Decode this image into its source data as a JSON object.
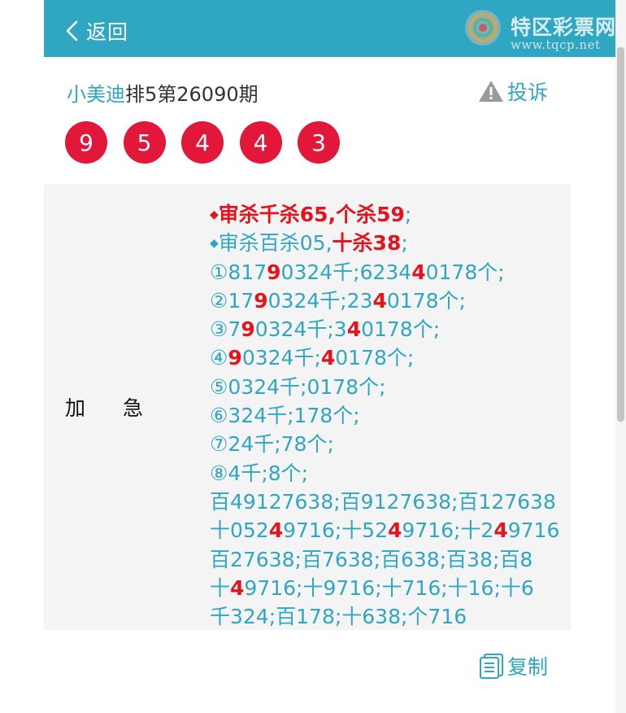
{
  "header": {
    "back_label": "返回"
  },
  "logo": {
    "name": "特区彩票网",
    "url": "www.tqcp.net"
  },
  "title": {
    "brand": "小美迪",
    "rest": "排5第26090期"
  },
  "complain_label": "投诉",
  "balls": [
    "9",
    "5",
    "4",
    "4",
    "3"
  ],
  "row_label": [
    "加",
    "急"
  ],
  "lines": [
    [
      {
        "t": "◆",
        "c": "d-red"
      },
      {
        "t": "审杀千杀65,个杀59",
        "c": "hl"
      },
      {
        "t": ";",
        "c": ""
      }
    ],
    [
      {
        "t": "◆",
        "c": "d-blue"
      },
      {
        "t": "审杀百杀05,",
        "c": ""
      },
      {
        "t": "十杀38",
        "c": "hl"
      },
      {
        "t": ";",
        "c": ""
      }
    ],
    [
      {
        "t": "①817",
        "c": ""
      },
      {
        "t": "9",
        "c": "hl"
      },
      {
        "t": "0324千;6234",
        "c": ""
      },
      {
        "t": "4",
        "c": "hl-skip"
      },
      {
        "t": "0178个;",
        "c": ""
      }
    ],
    [
      {
        "t": "②17",
        "c": ""
      },
      {
        "t": "9",
        "c": "hl"
      },
      {
        "t": "0324千;23",
        "c": ""
      },
      {
        "t": "4",
        "c": "hl"
      },
      {
        "t": "0178个;",
        "c": ""
      }
    ],
    [
      {
        "t": "③7",
        "c": ""
      },
      {
        "t": "9",
        "c": "hl"
      },
      {
        "t": "0324千;3",
        "c": ""
      },
      {
        "t": "4",
        "c": "hl"
      },
      {
        "t": "0178个;",
        "c": ""
      }
    ],
    [
      {
        "t": "④",
        "c": ""
      },
      {
        "t": "9",
        "c": "hl"
      },
      {
        "t": "0324千;",
        "c": ""
      },
      {
        "t": "4",
        "c": "hl"
      },
      {
        "t": "0178个;",
        "c": ""
      }
    ],
    [
      {
        "t": "⑤0324千;0178个;",
        "c": ""
      }
    ],
    [
      {
        "t": "⑥324千;178个;",
        "c": ""
      }
    ],
    [
      {
        "t": "⑦24千;78个;",
        "c": ""
      }
    ],
    [
      {
        "t": "⑧4千;8个;",
        "c": ""
      }
    ],
    [
      {
        "t": "百49127638;百9127638;百127638",
        "c": ""
      }
    ],
    [
      {
        "t": "十052",
        "c": ""
      },
      {
        "t": "4",
        "c": "hl"
      },
      {
        "t": "9716;十52",
        "c": ""
      },
      {
        "t": "4",
        "c": "hl"
      },
      {
        "t": "9716;十2",
        "c": ""
      },
      {
        "t": "4",
        "c": "hl"
      },
      {
        "t": "9716",
        "c": ""
      }
    ],
    [
      {
        "t": "百27638;百7638;百638;百38;百8",
        "c": ""
      }
    ],
    [
      {
        "t": "十",
        "c": ""
      },
      {
        "t": "4",
        "c": "hl"
      },
      {
        "t": "9716;十9716;十716;十16;十6",
        "c": ""
      }
    ],
    [
      {
        "t": "千324;百178;十638;个716",
        "c": ""
      }
    ]
  ],
  "copy_label": "复制",
  "colors": {
    "header": "#30a7c2",
    "ball": "#e3173a",
    "highlight": "#e6121c",
    "panel": "#f4f4f4"
  }
}
